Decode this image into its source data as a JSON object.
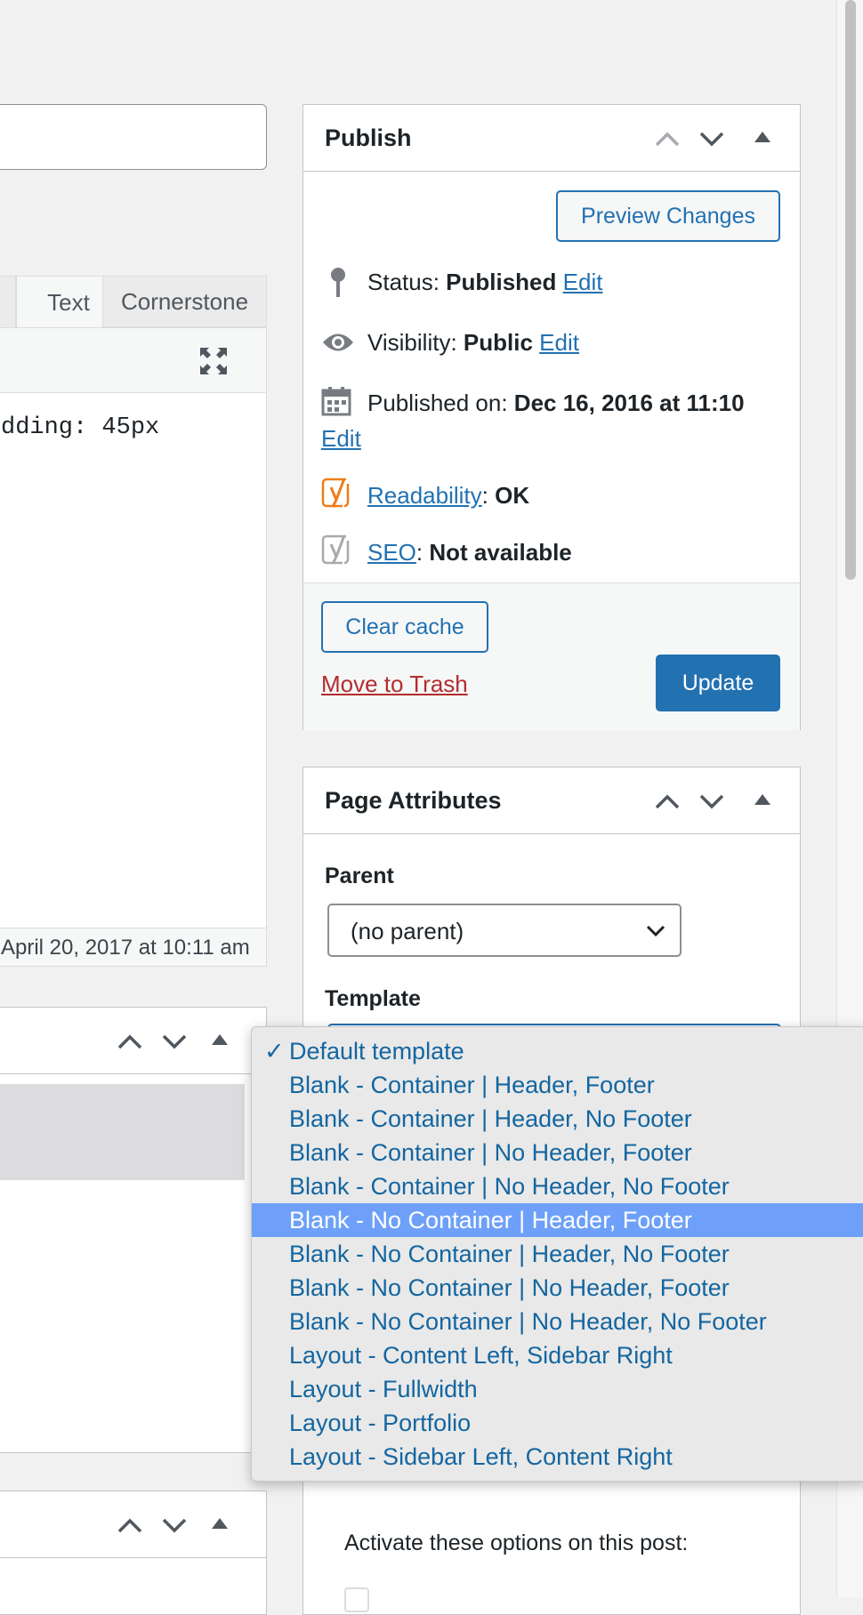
{
  "editor": {
    "tabs": [
      "Text",
      "Cornerstone"
    ],
    "code_text": "dding: 45px",
    "last_edited": "April 20, 2017 at 10:11 am"
  },
  "publish": {
    "title": "Publish",
    "preview_button": "Preview Changes",
    "status_label": "Status: ",
    "status_value": "Published",
    "visibility_label": "Visibility: ",
    "visibility_value": "Public",
    "published_label": "Published on: ",
    "published_value": "Dec 16, 2016 at 11:10",
    "edit_label": "Edit",
    "readability_link": "Readability",
    "readability_value": "OK",
    "seo_link": "SEO",
    "seo_value": "Not available",
    "clear_cache_button": "Clear cache",
    "trash_link": "Move to Trash",
    "update_button": "Update"
  },
  "page_attributes": {
    "title": "Page Attributes",
    "parent_label": "Parent",
    "parent_value": "(no parent)",
    "template_label": "Template"
  },
  "template_dropdown": {
    "check": "✓",
    "options": [
      "Default template",
      "Blank - Container | Header, Footer",
      "Blank - Container | Header, No Footer",
      "Blank - Container | No Header, Footer",
      "Blank - Container | No Header, No Footer",
      "Blank - No Container | Header, Footer",
      "Blank - No Container | Header, No Footer",
      "Blank - No Container | No Header, Footer",
      "Blank - No Container | No Header, No Footer",
      "Layout - Content Left, Sidebar Right",
      "Layout - Fullwidth",
      "Layout - Portfolio",
      "Layout - Sidebar Left, Content Right"
    ],
    "checked_index": 0,
    "highlighted_index": 5
  },
  "bottom_box": {
    "text": "Activate these options on this post:"
  },
  "colors": {
    "accent": "#2271b1",
    "trash": "#b32d2e",
    "highlight": "#6ea0f9",
    "yoast_orange": "#ee7c1b"
  }
}
